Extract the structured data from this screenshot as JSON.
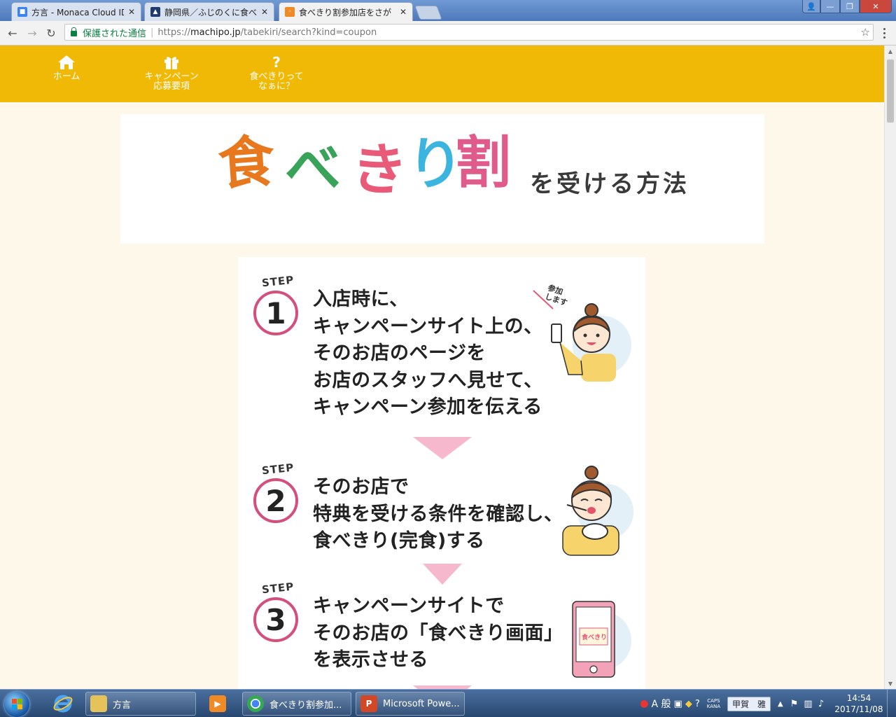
{
  "browser": {
    "tabs": [
      {
        "title": "方言 - Monaca Cloud IDE",
        "favicon_color": "#3b82f6",
        "active": false
      },
      {
        "title": "静岡県／ふじのくに食べきり",
        "favicon_color": "#1e3a6e",
        "active": false
      },
      {
        "title": "食べきり割参加店をさが",
        "favicon_color": "#f08a24",
        "active": true
      }
    ],
    "window_buttons": {
      "user": "👤",
      "minimize": "—",
      "maximize": "❐",
      "close": "✕"
    },
    "security_label": "保護された通信",
    "url_scheme": "https://",
    "url_host": "machipo.jp",
    "url_path": "/tabekiri/search?kind=coupon",
    "nav": {
      "back": "←",
      "forward": "→",
      "reload": "↻",
      "star": "☆"
    }
  },
  "site": {
    "nav": [
      {
        "icon": "⌂",
        "label": "ホーム"
      },
      {
        "icon": "🎁",
        "label": "キャンペーン\n応募要項"
      },
      {
        "icon": "?",
        "label": "食べきりって\nなぁに？"
      }
    ],
    "banner": {
      "chars": [
        {
          "text": "食",
          "color": "#e8781e"
        },
        {
          "text": "べ",
          "color": "#3aa35a"
        },
        {
          "text": "き",
          "color": "#e85a78"
        },
        {
          "text": "り",
          "color": "#3bb4e0"
        },
        {
          "text": "割",
          "color": "#e05a8a"
        }
      ],
      "subtitle": "を受ける方法"
    },
    "steps": [
      {
        "label": "STEP",
        "number": "1",
        "text": "入店時に、\nキャンペーンサイト上の、\nそのお店のページを\nお店のスタッフへ見せて、\nキャンペーン参加を伝える",
        "bubble": "参加\nします"
      },
      {
        "label": "STEP",
        "number": "2",
        "text": "そのお店で\n特典を受ける条件を確認し、\n食べきり(完食)する"
      },
      {
        "label": "STEP",
        "number": "3",
        "text": "キャンペーンサイトで\nそのお店の「食べきり画面」\nを表示させる",
        "phone_title": "食べきり"
      }
    ],
    "colors": {
      "nav_bg": "#f0b906",
      "page_bg": "#fdf8ea",
      "accent_pink": "#d4507b",
      "arrow_pink": "#f5b8cc"
    }
  },
  "taskbar": {
    "items": [
      {
        "label": "方言",
        "icon": "folder"
      },
      {
        "label": "食べきり割参加...",
        "icon": "chrome"
      },
      {
        "label": "Microsoft Powe...",
        "icon": "powerpoint"
      }
    ],
    "ime": {
      "mode": "A 般",
      "caps": "CAPS",
      "kana": "KANA",
      "user": "甲賀　雅"
    },
    "time": "14:54",
    "date": "2017/11/08"
  }
}
